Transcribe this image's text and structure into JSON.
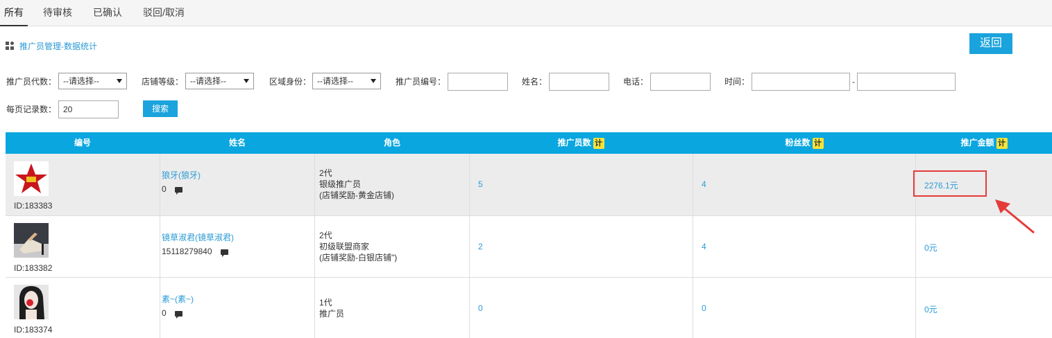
{
  "tabs": [
    "所有",
    "待审核",
    "已确认",
    "驳回/取消"
  ],
  "breadcrumb": "推广员管理-数据统计",
  "back_label": "返回",
  "filters": {
    "gen_label": "推广员代数：",
    "gen_value": "--请选择--",
    "store_label": "店铺等级：",
    "store_value": "--请选择--",
    "region_label": "区域身份：",
    "region_value": "--请选择--",
    "code_label": "推广员编号：",
    "name_label": "姓名：",
    "phone_label": "电话：",
    "time_label": "时间：",
    "dash": "-",
    "per_page_label": "每页记录数：",
    "per_page_value": "20",
    "search_label": "搜索"
  },
  "columns": {
    "id": "编号",
    "name": "姓名",
    "role": "角色",
    "promoters": "推广员数",
    "fans": "粉丝数",
    "amount": "推广金额",
    "calc_badge": "计"
  },
  "rows": [
    {
      "id": "ID:183383",
      "name": "狼牙(狼牙)",
      "sub": "0",
      "role1": "2代",
      "role2": "银级推广员",
      "role3": "(店铺奖励-黄金店铺)",
      "promoters": "5",
      "fans": "4",
      "amount": "2276.1元",
      "avatar_icon": "red-star-avatar-icon"
    },
    {
      "id": "ID:183382",
      "name": "镜草淑君(镜草淑君)",
      "sub": "15118279840",
      "role1": "2代",
      "role2": "初级联盟商家",
      "role3": "(店铺奖励-白银店铺\")",
      "promoters": "2",
      "fans": "4",
      "amount": "0元",
      "avatar_icon": "high-heel-avatar-icon"
    },
    {
      "id": "ID:183374",
      "name": "素~(素~)",
      "sub": "0",
      "role1": "1代",
      "role2": "推广员",
      "role3": "",
      "promoters": "0",
      "fans": "0",
      "amount": "0元",
      "avatar_icon": "portrait-avatar-icon"
    }
  ],
  "colors": {
    "header_bg": "#0aa6df",
    "link": "#2a9bd5",
    "highlight": "#e53a3a"
  }
}
